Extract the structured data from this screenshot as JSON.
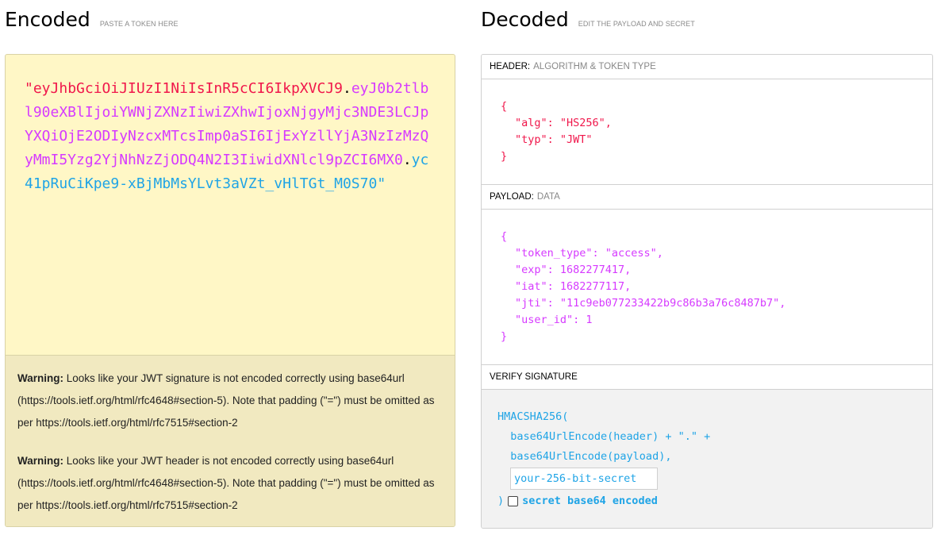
{
  "encoded": {
    "title": "Encoded",
    "subtitle": "PASTE A TOKEN HERE",
    "token": {
      "quote_open": "\"",
      "header": "eyJhbGciOiJIUzI1NiIsInR5cCI6IkpXVCJ9",
      "payload": "eyJ0b2tlbl90eXBlIjoiYWNjZXNzIiwiZXhwIjoxNjgyMjc3NDE3LCJpYXQiOjE2ODIyNzcxMTcsImp0aSI6IjExYzllYjA3NzIzMzQyMmI5Yzg2YjNhNzZjODQ4N2I3IiwidXNlcl9pZCI6MX0",
      "signature": "yc41pRuCiKpe9-xBjMbMsYLvt3aVZt_vHlTGt_M0S70",
      "quote_close": "\"",
      "dot": "."
    },
    "warnings": [
      {
        "label": "Warning:",
        "text": " Looks like your JWT signature is not encoded correctly using base64url (https://tools.ietf.org/html/rfc4648#section-5). Note that padding (\"=\") must be omitted as per https://tools.ietf.org/html/rfc7515#section-2"
      },
      {
        "label": "Warning:",
        "text": " Looks like your JWT header is not encoded correctly using base64url (https://tools.ietf.org/html/rfc4648#section-5). Note that padding (\"=\") must be omitted as per https://tools.ietf.org/html/rfc7515#section-2"
      }
    ]
  },
  "decoded": {
    "title": "Decoded",
    "subtitle": "EDIT THE PAYLOAD AND SECRET",
    "header_section": {
      "label": "HEADER:",
      "sublabel": "ALGORITHM & TOKEN TYPE",
      "lines": [
        "{",
        "\"alg\": \"HS256\",",
        "\"typ\": \"JWT\"",
        "}"
      ]
    },
    "payload_section": {
      "label": "PAYLOAD:",
      "sublabel": "DATA",
      "lines": [
        "{",
        "\"token_type\": \"access\",",
        "\"exp\": 1682277417,",
        "\"iat\": 1682277117,",
        "\"jti\": \"11c9eb077233422b9c86b3a76c8487b7\",",
        "\"user_id\": 1",
        "}"
      ]
    },
    "verify_section": {
      "label": "VERIFY SIGNATURE",
      "line1": "HMACSHA256(",
      "line2": "  base64UrlEncode(header) + \".\" +",
      "line3": "  base64UrlEncode(payload),",
      "secret_placeholder": "your-256-bit-secret",
      "close_paren": ")",
      "checkbox_label": "secret base64 encoded",
      "checkbox_checked": false
    }
  },
  "colors": {
    "header": "#f0174b",
    "payload": "#d63aff",
    "signature": "#1fa4e6",
    "encoded_bg": "#fff7c6",
    "warning_bg": "#f1e9c0"
  }
}
